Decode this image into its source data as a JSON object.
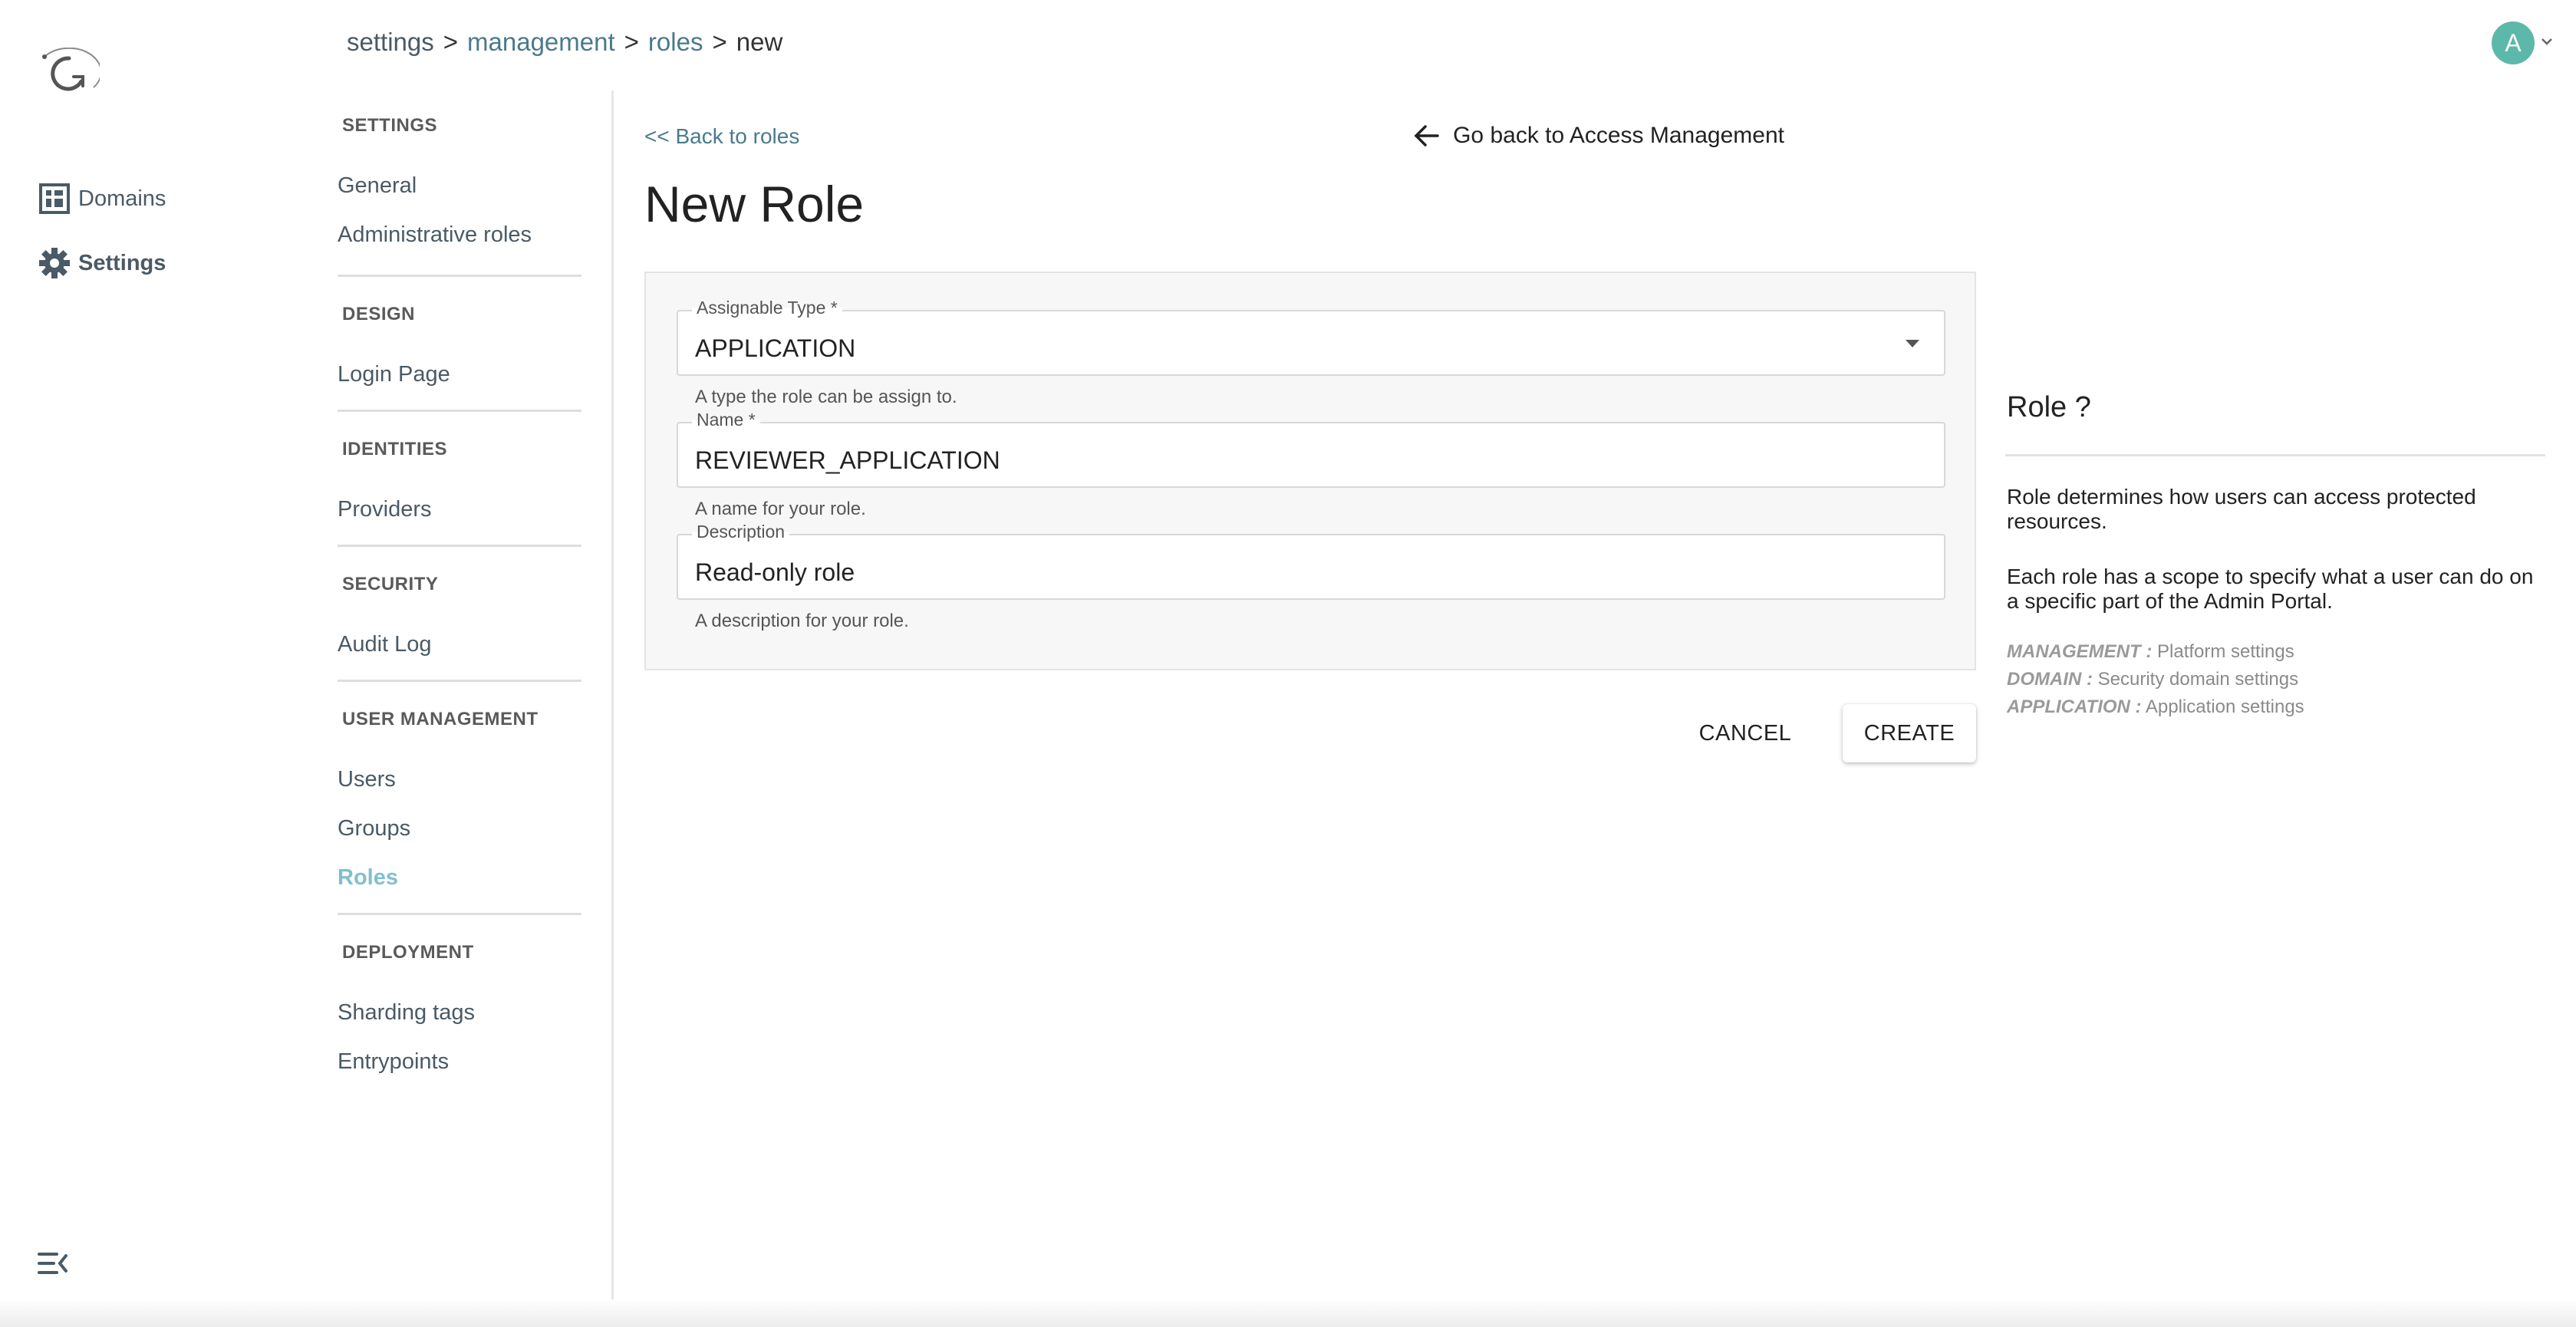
{
  "rail": {
    "items": [
      {
        "label": "Domains",
        "icon": "domains-grid-icon"
      },
      {
        "label": "Settings",
        "icon": "gear-icon"
      }
    ]
  },
  "breadcrumb": {
    "root": "settings",
    "items": [
      "management",
      "roles"
    ],
    "current": "new",
    "separator": ">"
  },
  "user": {
    "initial": "A",
    "color": "#5cb8a8"
  },
  "settings_nav": {
    "sections": [
      {
        "title": "SETTINGS",
        "links": [
          "General",
          "Administrative roles"
        ]
      },
      {
        "title": "DESIGN",
        "links": [
          "Login Page"
        ]
      },
      {
        "title": "IDENTITIES",
        "links": [
          "Providers"
        ]
      },
      {
        "title": "SECURITY",
        "links": [
          "Audit Log"
        ]
      },
      {
        "title": "USER MANAGEMENT",
        "links": [
          "Users",
          "Groups",
          "Roles"
        ]
      },
      {
        "title": "DEPLOYMENT",
        "links": [
          "Sharding tags",
          "Entrypoints"
        ]
      }
    ],
    "selected": "Roles",
    "selected_color": "#80bfcf"
  },
  "main": {
    "back_link": "<< Back to roles",
    "go_back": "Go back to Access Management",
    "title": "New Role",
    "form": {
      "assignable_type": {
        "label": "Assignable Type *",
        "value": "APPLICATION",
        "hint": "A type the role can be assign to."
      },
      "name": {
        "label": "Name *",
        "value": "REVIEWER_APPLICATION",
        "hint": "A name for your role."
      },
      "description": {
        "label": "Description",
        "value": "Read-only role",
        "hint": "A description for your role."
      }
    },
    "cancel_label": "CANCEL",
    "create_label": "CREATE"
  },
  "help": {
    "title": "Role ?",
    "p1": "Role determines how users can access protected resources.",
    "p2": "Each role has a scope to specify what a user can do on a specific part of the Admin Portal.",
    "scopes": [
      {
        "name": "MANAGEMENT :",
        "desc": "Platform settings"
      },
      {
        "name": "DOMAIN :",
        "desc": "Security domain settings"
      },
      {
        "name": "APPLICATION :",
        "desc": "Application settings"
      }
    ]
  }
}
